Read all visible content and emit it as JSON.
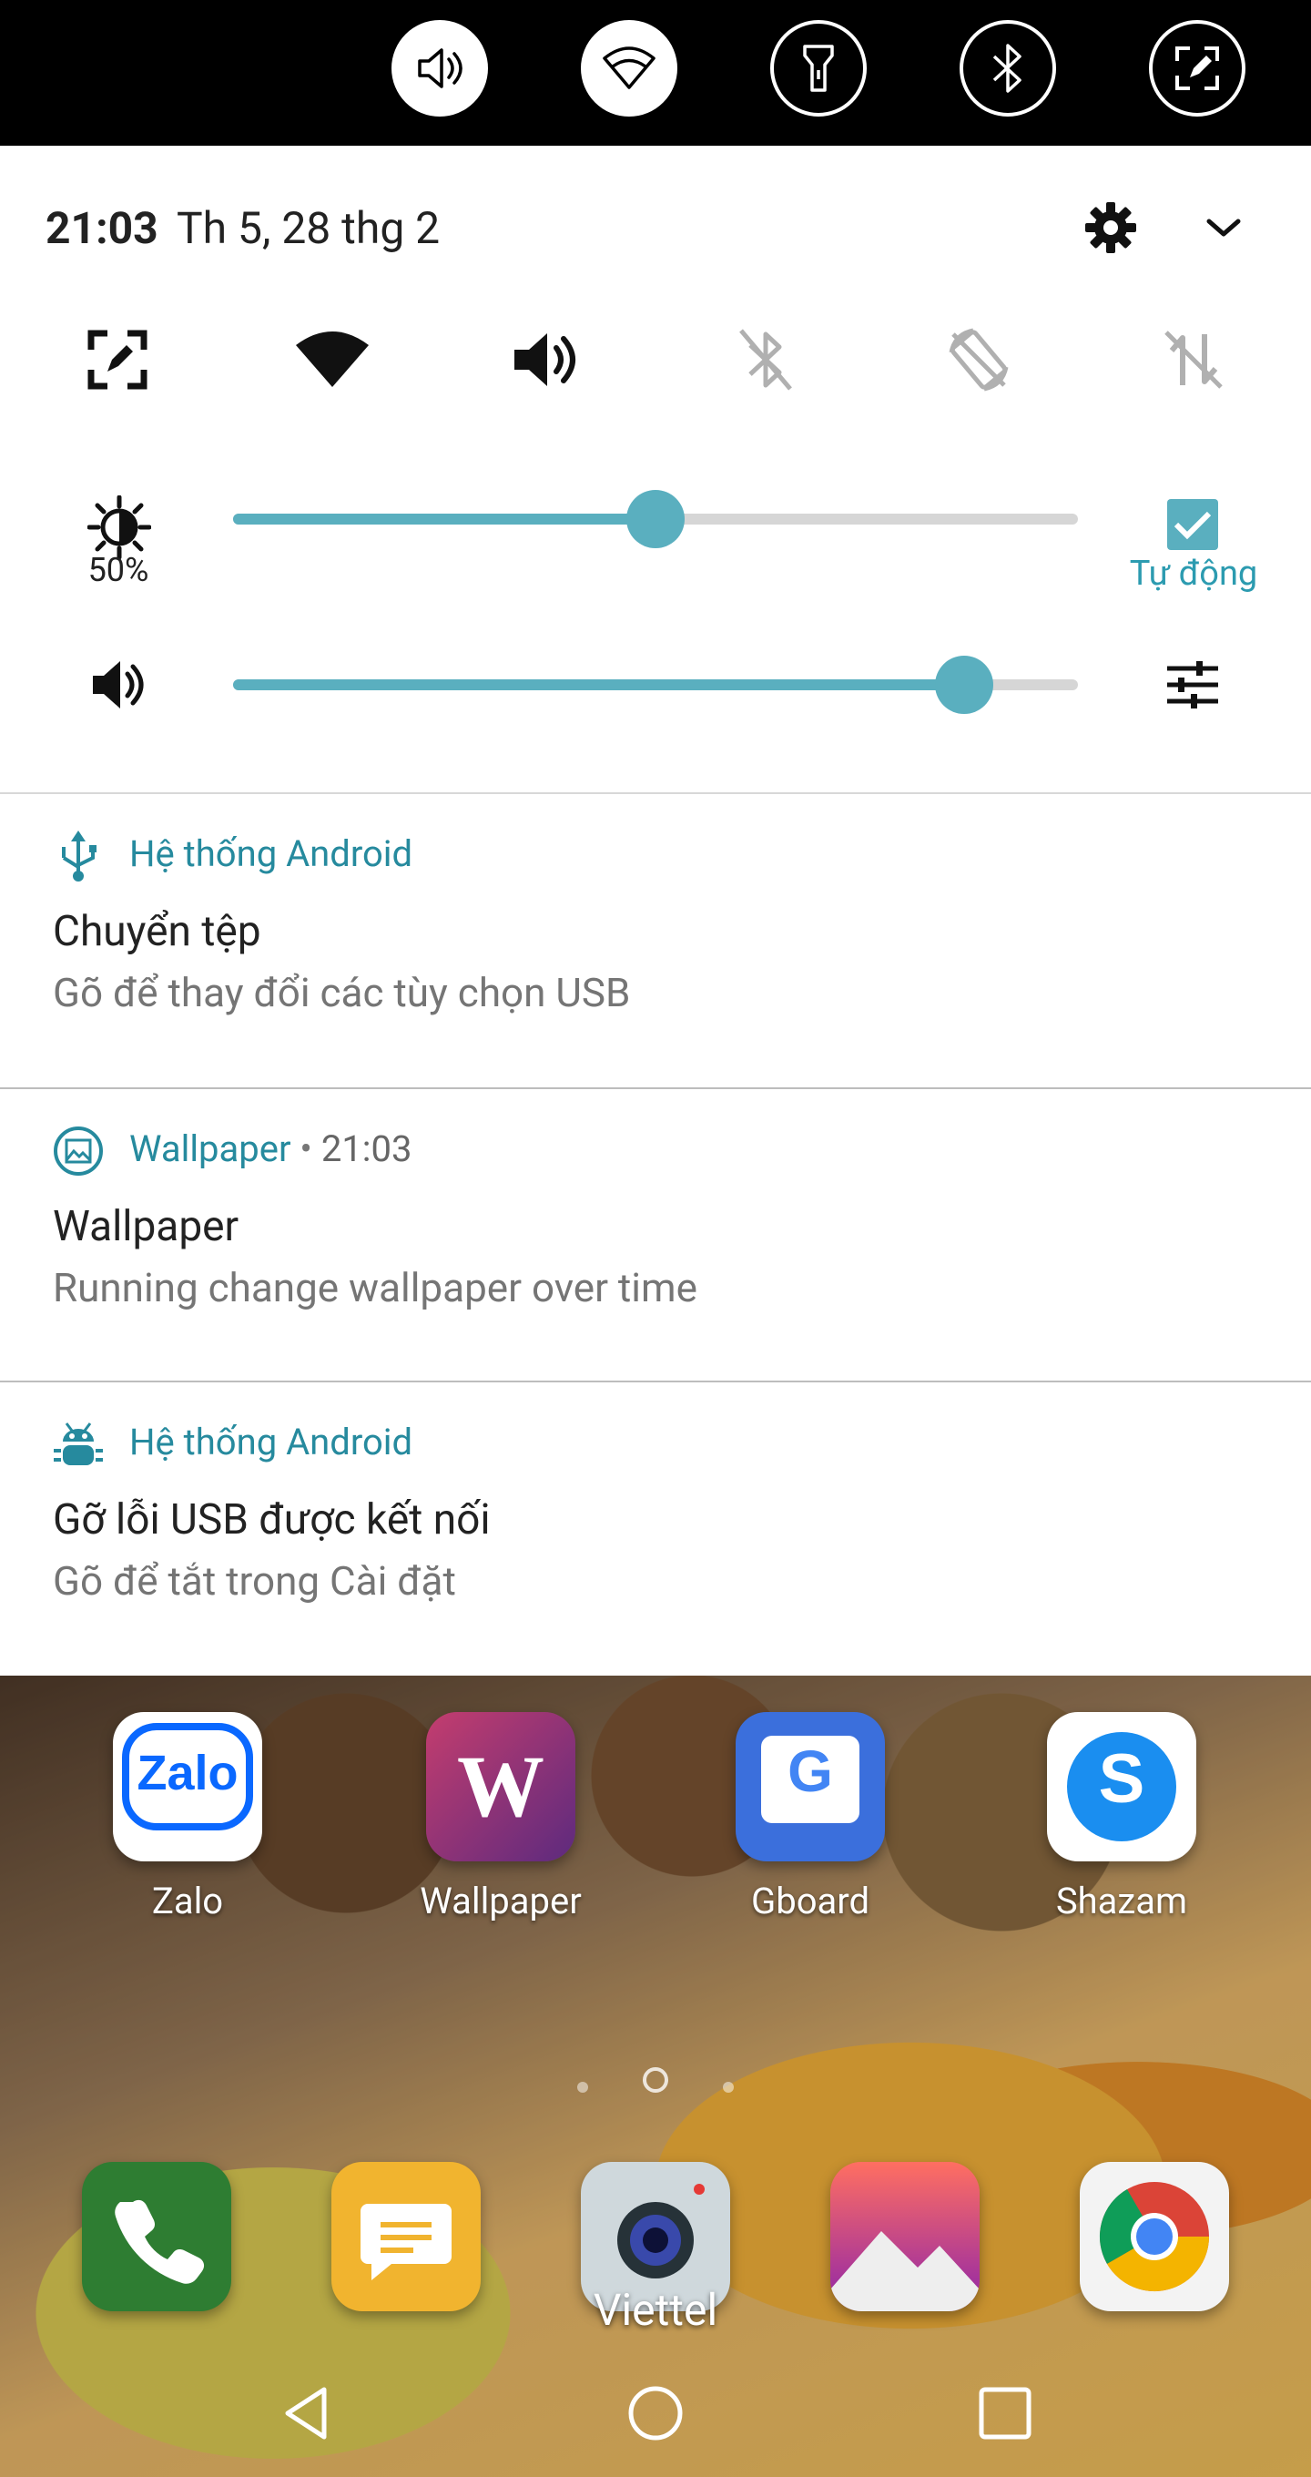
{
  "colors": {
    "accent": "#5aafbf",
    "app_name": "#268a9e",
    "statusbar": "#000000",
    "shade": "#ffffff"
  },
  "statusbar": {
    "toggles": [
      {
        "icon": "volume-icon",
        "state": "on"
      },
      {
        "icon": "wifi-icon",
        "state": "on"
      },
      {
        "icon": "flashlight-icon",
        "state": "off"
      },
      {
        "icon": "bluetooth-icon",
        "state": "off"
      },
      {
        "icon": "screen-capture-icon",
        "state": "off"
      }
    ]
  },
  "shade": {
    "time": "21:03",
    "date": "Th 5, 28 thg 2",
    "tiles": [
      {
        "icon": "screen-capture-icon",
        "state": "on"
      },
      {
        "icon": "wifi-icon",
        "state": "on"
      },
      {
        "icon": "volume-icon",
        "state": "on"
      },
      {
        "icon": "bluetooth-off-icon",
        "state": "off"
      },
      {
        "icon": "rotation-lock-icon",
        "state": "off"
      },
      {
        "icon": "data-off-icon",
        "state": "off"
      }
    ],
    "brightness": {
      "percent_label": "50%",
      "level": 0.5,
      "auto_checked": true,
      "auto_label": "Tự động"
    },
    "volume": {
      "level": 0.865
    }
  },
  "notifications": [
    {
      "icon": "usb-icon",
      "app": "Hệ thống Android",
      "time": "",
      "title": "Chuyển tệp",
      "body": "Gõ để thay đổi các tùy chọn USB"
    },
    {
      "icon": "wallpaper-icon",
      "app": "Wallpaper",
      "time": "21:03",
      "title": "Wallpaper",
      "body": "Running change wallpaper over time"
    },
    {
      "icon": "bug-icon",
      "app": "Hệ thống Android",
      "time": "",
      "title": "Gỡ lỗi USB được kết nối",
      "body": "Gõ để tắt trong Cài đặt"
    }
  ],
  "home": {
    "apps": [
      {
        "label": "Zalo",
        "icon_text": "Zalo"
      },
      {
        "label": "Wallpaper",
        "icon_text": ""
      },
      {
        "label": "Gboard",
        "icon_text": "G"
      },
      {
        "label": "Shazam",
        "icon_text": "S"
      }
    ],
    "dock": [
      {
        "icon": "phone-icon"
      },
      {
        "icon": "messages-icon"
      },
      {
        "icon": "camera-icon"
      },
      {
        "icon": "gallery-icon"
      },
      {
        "icon": "chrome-icon"
      }
    ],
    "carrier": "Viettel",
    "page_count": 3,
    "active_page": 2
  },
  "navbar": {
    "buttons": [
      "back",
      "home",
      "recents"
    ]
  }
}
